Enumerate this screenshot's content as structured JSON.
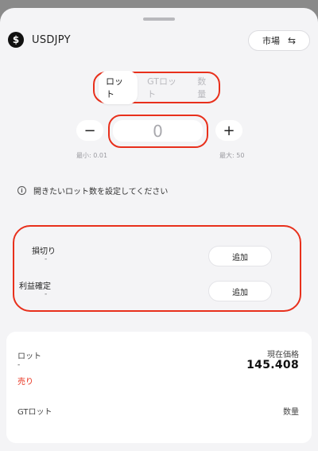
{
  "header": {
    "symbol": "USDJPY",
    "coin_glyph": "$",
    "market_label": "市場",
    "swap_glyph": "⇆"
  },
  "tabs": [
    {
      "label": "ロット",
      "active": true
    },
    {
      "label": "GTロット",
      "active": false
    },
    {
      "label": "数量",
      "active": false
    }
  ],
  "quantity": {
    "minus": "−",
    "plus": "+",
    "value": "0",
    "min_label": "最小: 0.01",
    "max_label": "最大: 50"
  },
  "info": {
    "icon": "i",
    "text": "開きたいロット数を設定してください"
  },
  "orders": {
    "stop_loss_label": "損切り",
    "stop_loss_value": "-",
    "take_profit_label": "利益確定",
    "take_profit_value": "-",
    "add_label": "追加"
  },
  "summary": {
    "lot_label": "ロット",
    "lot_value": "-",
    "side": "売り",
    "price_label": "現在価格",
    "price": "145.408",
    "gt_lot_label": "GTロット",
    "qty_label": "数量"
  },
  "colors": {
    "highlight": "#e8301c",
    "sell": "#e8301c",
    "sheet_bg": "#f4f4f6"
  }
}
